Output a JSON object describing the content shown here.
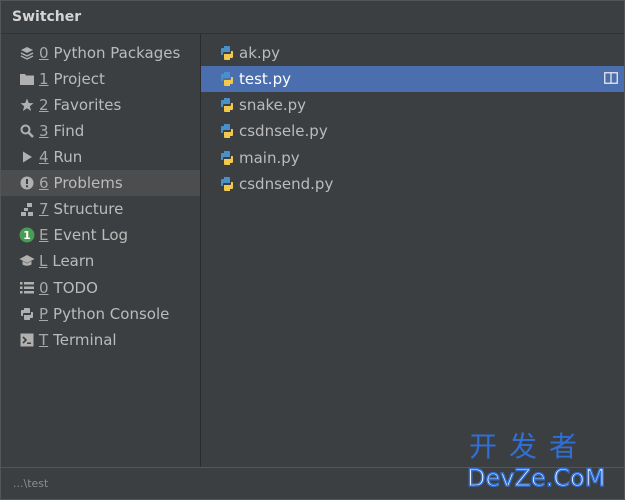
{
  "window": {
    "title": "Switcher"
  },
  "tool_windows": [
    {
      "mnemonic": "0",
      "label": "Python Packages",
      "icon": "layers-icon"
    },
    {
      "mnemonic": "1",
      "label": "Project",
      "icon": "folder-icon"
    },
    {
      "mnemonic": "2",
      "label": "Favorites",
      "icon": "star-icon"
    },
    {
      "mnemonic": "3",
      "label": "Find",
      "icon": "search-icon"
    },
    {
      "mnemonic": "4",
      "label": "Run",
      "icon": "play-icon"
    },
    {
      "mnemonic": "6",
      "label": "Problems",
      "icon": "warning-icon",
      "selected": true
    },
    {
      "mnemonic": "7",
      "label": "Structure",
      "icon": "structure-icon"
    },
    {
      "mnemonic": "E",
      "label": "Event Log",
      "icon": "event-log-icon",
      "badge": "1"
    },
    {
      "mnemonic": "L",
      "label": "Learn",
      "icon": "graduation-cap-icon"
    },
    {
      "mnemonic": "0",
      "label": "TODO",
      "icon": "list-icon"
    },
    {
      "mnemonic": "P",
      "label": "Python Console",
      "icon": "python-icon"
    },
    {
      "mnemonic": "T",
      "label": "Terminal",
      "icon": "terminal-icon"
    }
  ],
  "files": [
    {
      "name": "ak.py"
    },
    {
      "name": "test.py",
      "selected": true
    },
    {
      "name": "snake.py"
    },
    {
      "name": "csdnsele.py"
    },
    {
      "name": "main.py"
    },
    {
      "name": "csdnsend.py"
    }
  ],
  "status": {
    "path": "...\\test"
  },
  "watermark": {
    "top": "开发者",
    "bottom": "DevZe.CoM"
  },
  "colors": {
    "background": "#3c3f41",
    "selected_file": "#4b6eaf",
    "selected_tool": "#4b4d4f",
    "badge": "#499c54",
    "python_blue": "#4a90c8",
    "python_yellow": "#f2c94c"
  }
}
